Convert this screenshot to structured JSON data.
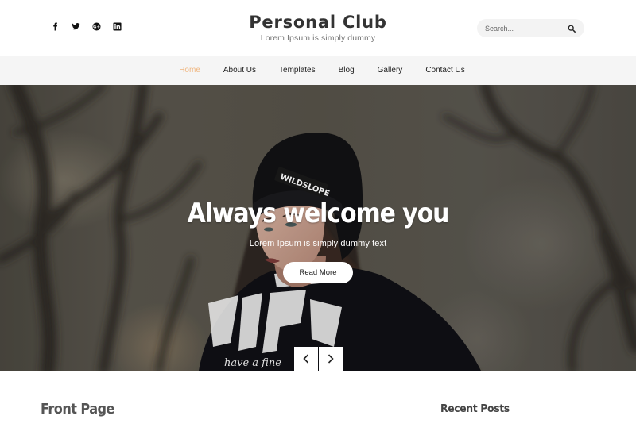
{
  "header": {
    "social": [
      {
        "name": "facebook",
        "icon": "facebook-icon"
      },
      {
        "name": "twitter",
        "icon": "twitter-icon"
      },
      {
        "name": "google-plus",
        "icon": "google-plus-icon"
      },
      {
        "name": "linkedin",
        "icon": "linkedin-icon"
      }
    ],
    "site_title": "Personal Club",
    "tagline": "Lorem Ipsum is simply dummy",
    "search": {
      "placeholder": "Search...",
      "value": "",
      "icon": "search-icon"
    }
  },
  "nav": {
    "items": [
      {
        "label": "Home",
        "active": true
      },
      {
        "label": "About Us",
        "active": false
      },
      {
        "label": "Templates",
        "active": false
      },
      {
        "label": "Blog",
        "active": false
      },
      {
        "label": "Gallery",
        "active": false
      },
      {
        "label": "Contact Us",
        "active": false
      }
    ],
    "active_color": "#f0b67f"
  },
  "hero": {
    "title": "Always welcome you",
    "subtitle": "Lorem Ipsum is simply dummy text",
    "button_label": "Read More",
    "hat_text": "WILDSLOPE",
    "shirt_text": "have a fine",
    "prev_icon": "chevron-left-icon",
    "next_icon": "chevron-right-icon"
  },
  "content": {
    "main_title": "Front Page",
    "sidebar_title": "Recent Posts"
  }
}
